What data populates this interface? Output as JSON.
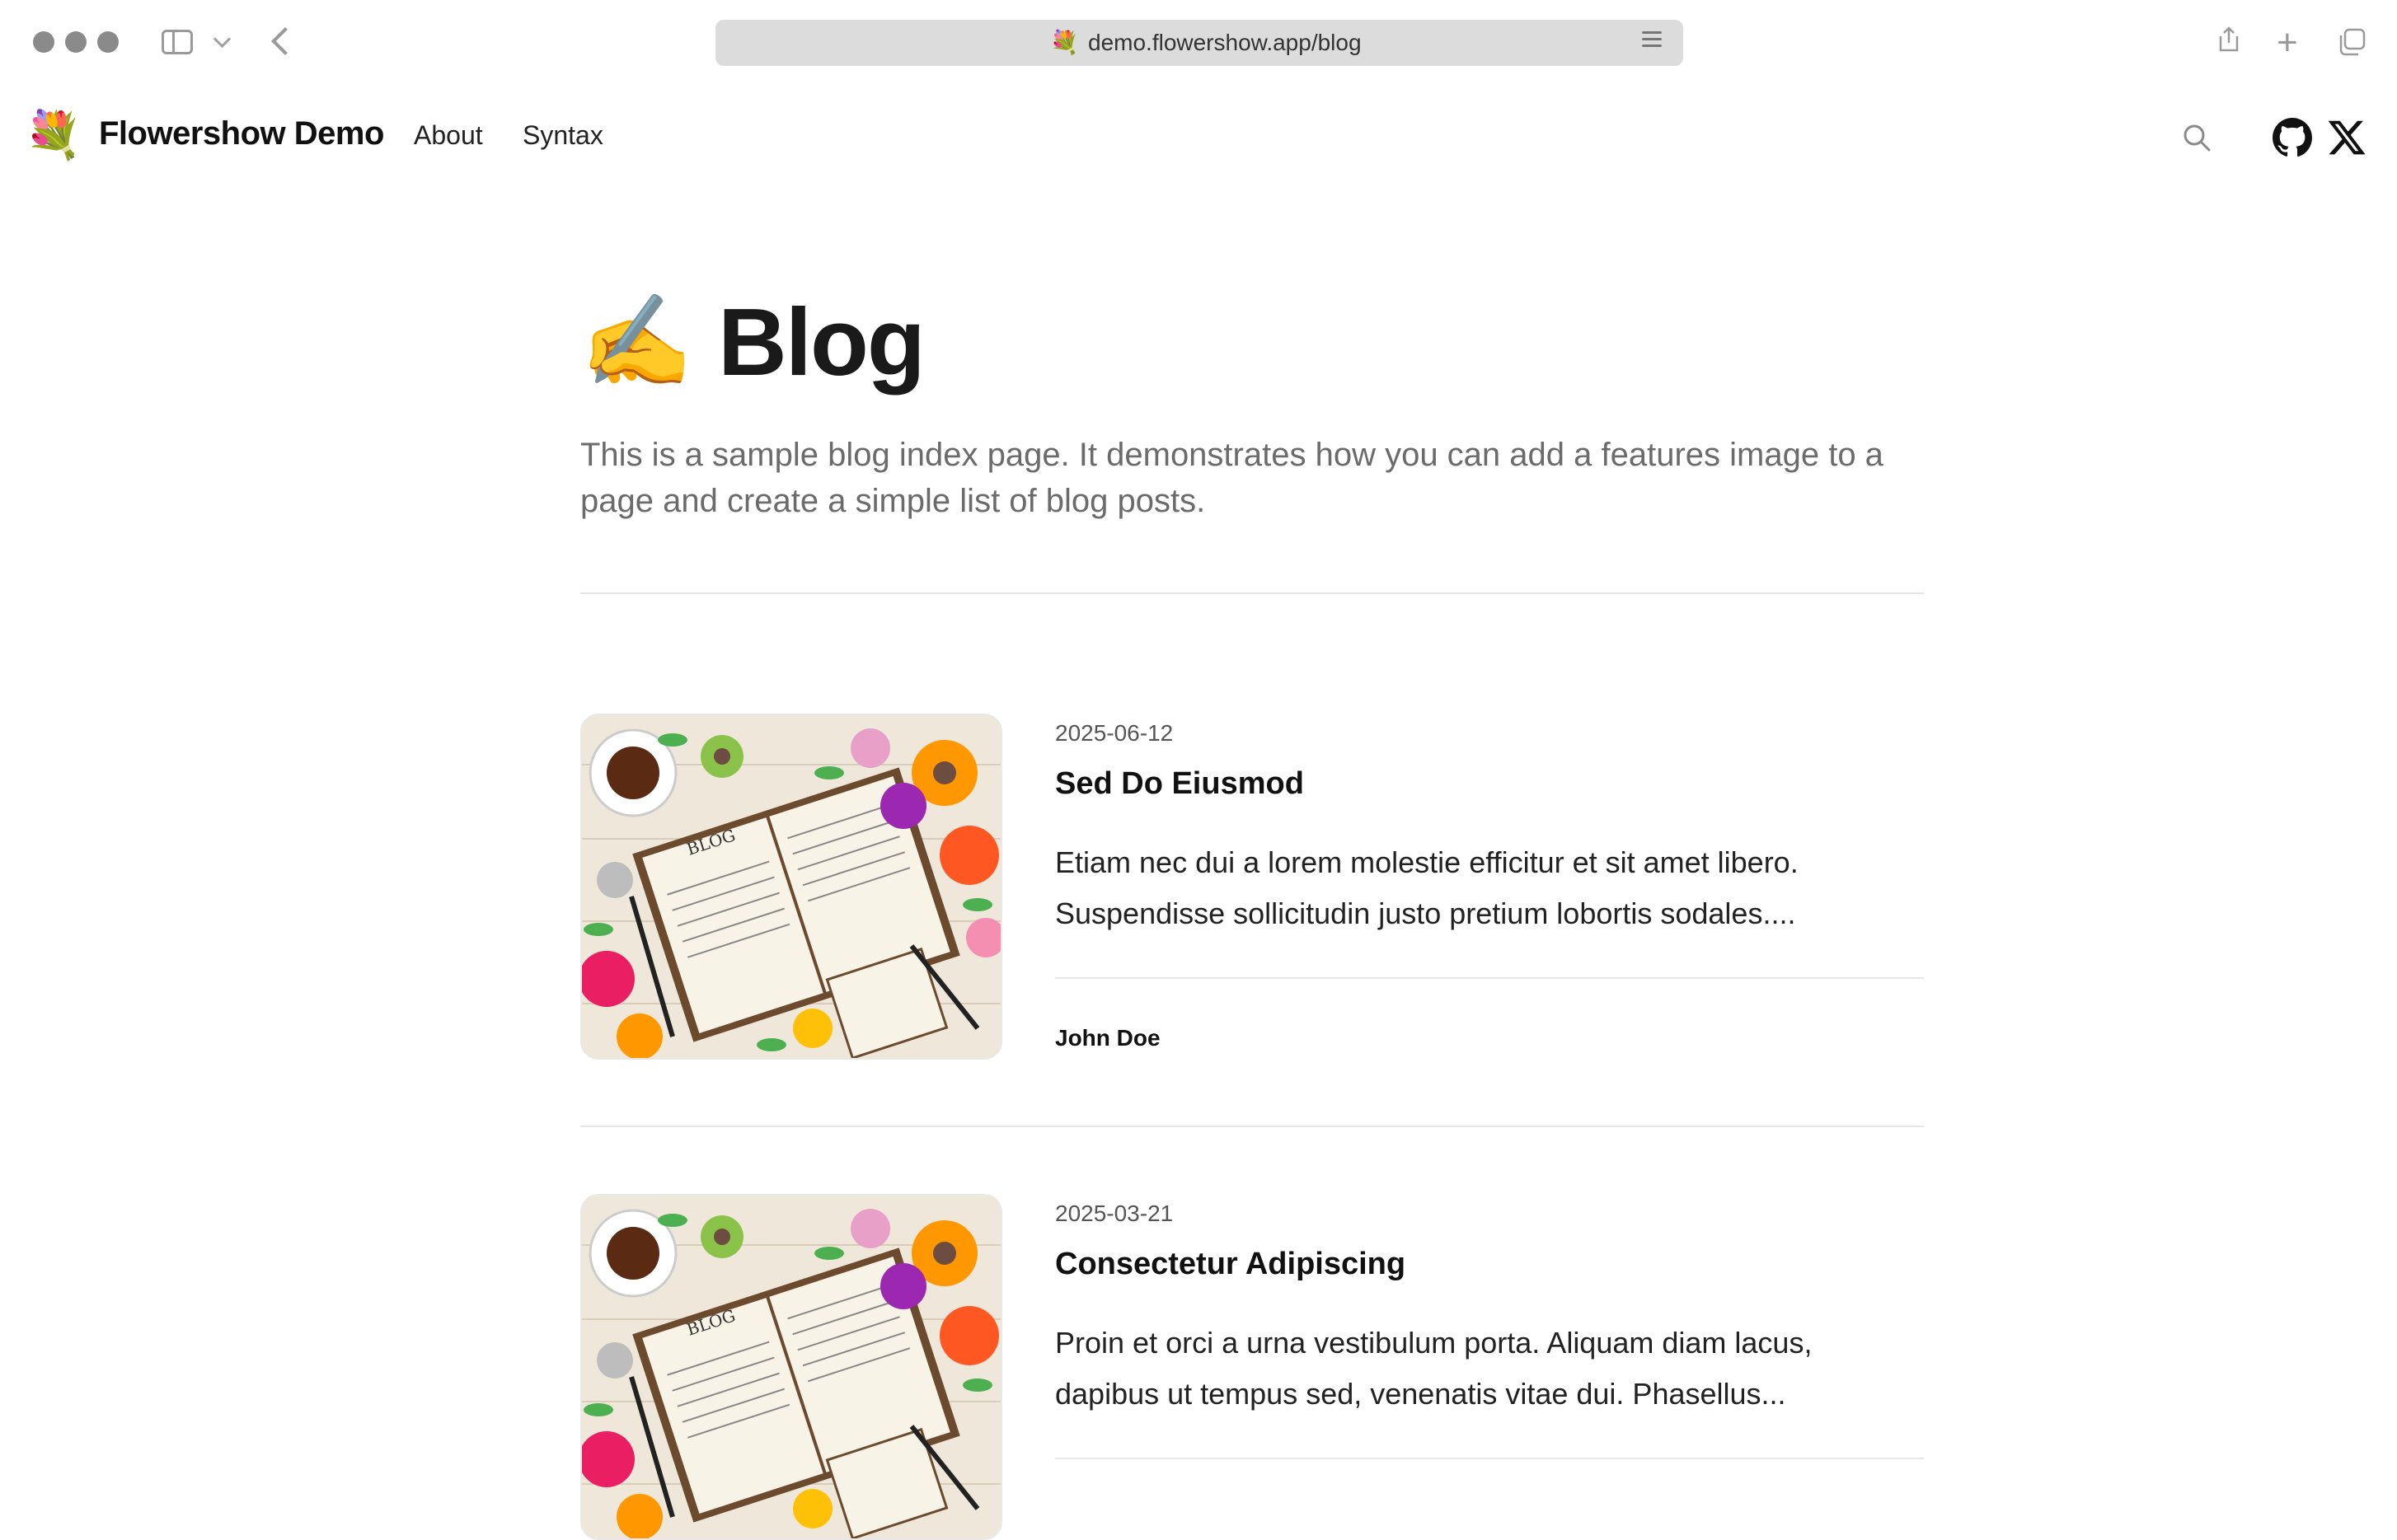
{
  "browser": {
    "url": "demo.flowershow.app/blog",
    "favicon": "💐"
  },
  "header": {
    "logo": "💐",
    "site_title": "Flowershow Demo",
    "nav": [
      {
        "label": "About"
      },
      {
        "label": "Syntax"
      }
    ]
  },
  "page": {
    "emoji": "✍️",
    "title": "Blog",
    "description": "This is a sample blog index page. It demonstrates how you can add a features image to a page and create a simple list of blog posts."
  },
  "posts": [
    {
      "date": "2025-06-12",
      "title": "Sed Do Eiusmod",
      "excerpt": "Etiam nec dui a lorem molestie efficitur et sit amet libero. Suspendisse sollicitudin justo pretium lobortis sodales....",
      "author": "John Doe",
      "image_label": "BLOG"
    },
    {
      "date": "2025-03-21",
      "title": "Consectetur Adipiscing",
      "excerpt": "Proin et orci a urna vestibulum porta. Aliquam diam lacus, dapibus ut tempus sed, venenatis vitae dui. Phasellus...",
      "author": "",
      "image_label": "BLOG"
    }
  ],
  "colors": {
    "accent_text": "#111111",
    "muted_text": "#6b6b6b",
    "divider": "#e6e6e6"
  }
}
